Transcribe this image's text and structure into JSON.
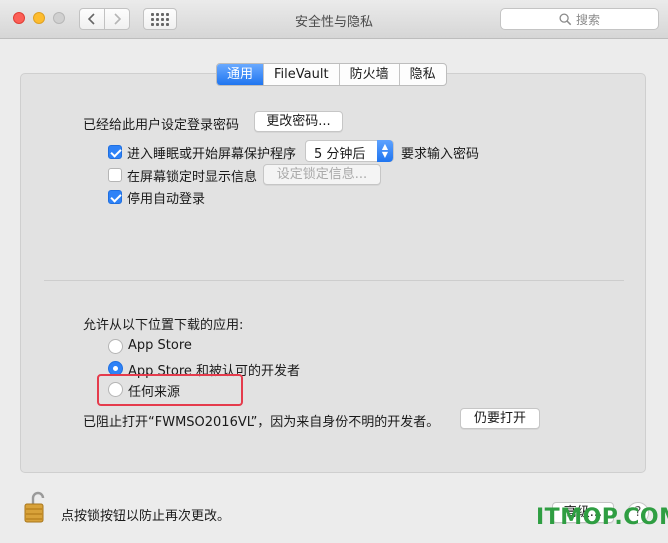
{
  "window": {
    "title": "安全性与隐私"
  },
  "search": {
    "placeholder": "搜索"
  },
  "tabs": [
    {
      "label": "通用",
      "active": true
    },
    {
      "label": "FileVault",
      "active": false
    },
    {
      "label": "防火墙",
      "active": false
    },
    {
      "label": "隐私",
      "active": false
    }
  ],
  "general": {
    "password_label": "已经给此用户设定登录密码",
    "change_password_button": "更改密码...",
    "require_password": {
      "label": "进入睡眠或开始屏幕保护程序",
      "checked": true,
      "delay_value": "5 分钟后",
      "suffix": "要求输入密码"
    },
    "show_message": {
      "label": "在屏幕锁定时显示信息",
      "checked": false,
      "button": "设定锁定信息..."
    },
    "disable_auto_login": {
      "label": "停用自动登录",
      "checked": true
    }
  },
  "downloads": {
    "heading": "允许从以下位置下载的应用:",
    "options": [
      {
        "label": "App Store",
        "selected": false
      },
      {
        "label": "App Store 和被认可的开发者",
        "selected": true
      },
      {
        "label": "任何来源",
        "selected": false
      }
    ],
    "blocked_message": "已阻止打开“FWMSO2016VL”，因为来自身份不明的开发者。",
    "open_anyway_button": "仍要打开"
  },
  "footer": {
    "lock_text": "点按锁按钮以防止再次更改。",
    "advanced_button": "高级...",
    "help_label": "?"
  },
  "watermark": {
    "text": "ITMOP.COM"
  },
  "colors": {
    "accent": "#2e82f7",
    "highlight": "#e53b4c",
    "watermark": "#2f9e42"
  }
}
